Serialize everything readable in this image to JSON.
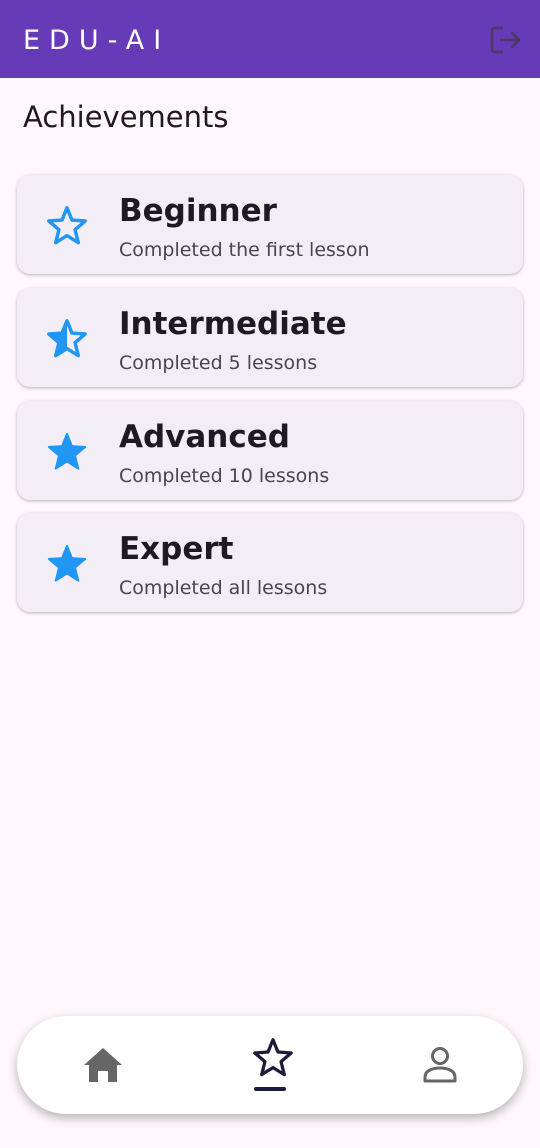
{
  "app_bar": {
    "title": "EDU-AI",
    "logout_icon": "logout-icon",
    "background": "#673ab7"
  },
  "page": {
    "title": "Achievements"
  },
  "achievements": [
    {
      "title": "Beginner",
      "description": "Completed the first lesson",
      "icon": "star-outline-icon"
    },
    {
      "title": "Intermediate",
      "description": "Completed 5 lessons",
      "icon": "star-half-icon"
    },
    {
      "title": "Advanced",
      "description": "Completed 10 lessons",
      "icon": "star-filled-icon"
    },
    {
      "title": "Expert",
      "description": "Completed all lessons",
      "icon": "star-filled-icon"
    }
  ],
  "bottom_nav": {
    "items": [
      {
        "name": "home",
        "icon": "home-icon"
      },
      {
        "name": "achievements",
        "icon": "star-outline-icon",
        "selected": true
      },
      {
        "name": "profile",
        "icon": "person-icon"
      }
    ]
  },
  "colors": {
    "accent_star": "#2196f3",
    "card_background": "#f3eef6",
    "page_background": "#fef7fc"
  }
}
